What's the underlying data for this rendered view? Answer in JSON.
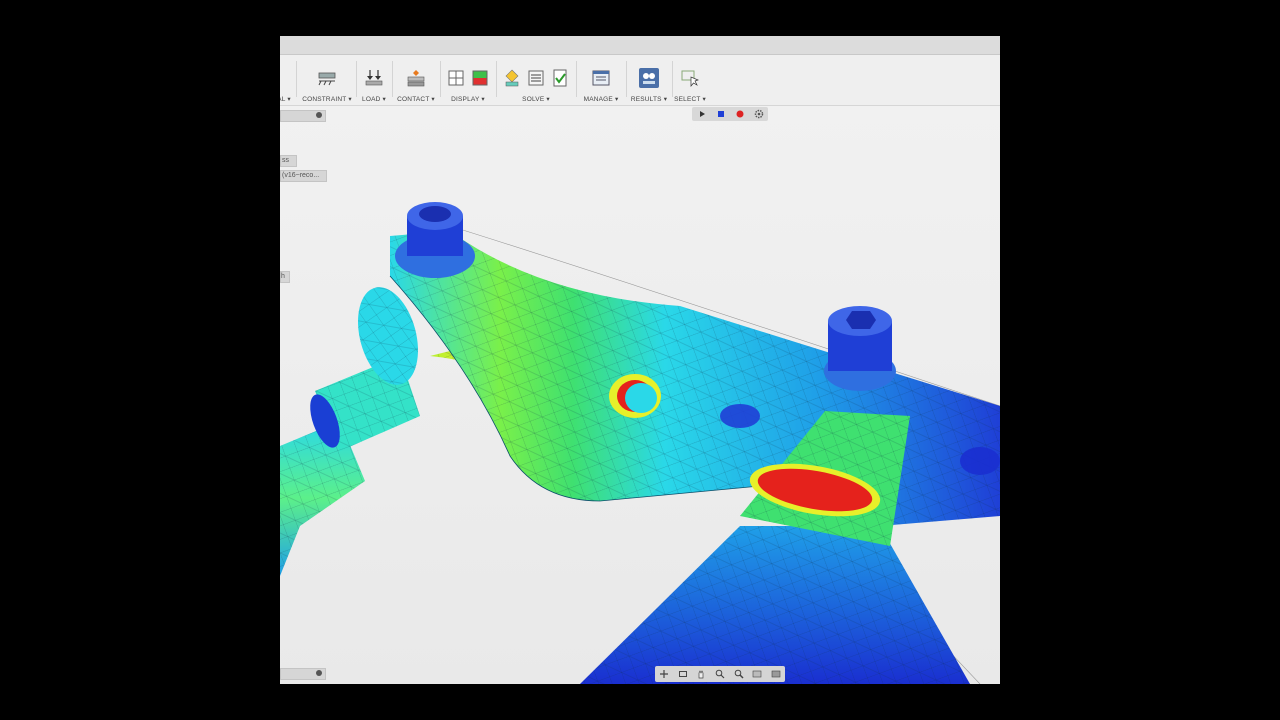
{
  "toolbar": {
    "groups": [
      {
        "label": "AL ▾",
        "icon": "material-icon"
      },
      {
        "label": "CONSTRAINT ▾",
        "icon": "constraint-icon"
      },
      {
        "label": "LOAD ▾",
        "icon": "load-icon"
      },
      {
        "label": "CONTACT ▾",
        "icon": "contact-icon"
      },
      {
        "label": "DISPLAY ▾",
        "icon": "display-icon"
      },
      {
        "label": "SOLVE ▾",
        "icon": "solve-icon"
      },
      {
        "label": "MANAGE ▾",
        "icon": "manage-icon"
      },
      {
        "label": "RESULTS ▾",
        "icon": "results-icon"
      },
      {
        "label": "SELECT ▾",
        "icon": "select-icon"
      }
    ]
  },
  "browser": {
    "top_chip": "",
    "item1": "ss",
    "item2": "(v16~reco...",
    "side_chip": "h"
  },
  "animation_controls": [
    "play-icon",
    "stop-icon",
    "record-icon",
    "settings-icon"
  ],
  "nav_bar": [
    "orbit-icon",
    "look-at-icon",
    "pan-icon",
    "zoom-icon",
    "fit-icon",
    "display-settings-icon",
    "grid-icon"
  ],
  "colors": {
    "accent_blue": "#1f3fd6",
    "stress_red": "#e5221c",
    "stress_yellow": "#e7f02a",
    "stress_green": "#3fe070",
    "stress_cyan": "#2ad8e8"
  }
}
